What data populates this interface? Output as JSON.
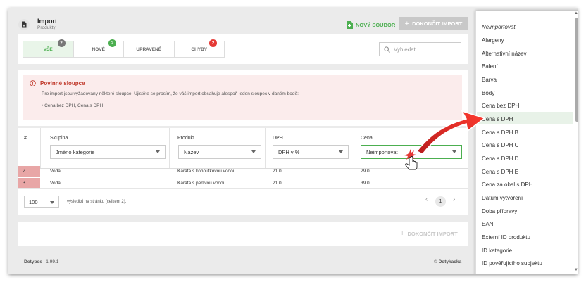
{
  "header": {
    "title": "Import",
    "subtitle": "Produkty",
    "new_file": "NOVÝ SOUBOR",
    "finish": "DOKONČIT IMPORT"
  },
  "tabs": [
    {
      "label": "VŠE",
      "count": "2",
      "badge_color": "#777777"
    },
    {
      "label": "NOVÉ",
      "count": "2",
      "badge_color": "#4caf50"
    },
    {
      "label": "UPRAVENÉ",
      "count": "",
      "badge_color": ""
    },
    {
      "label": "CHYBY",
      "count": "2",
      "badge_color": "#e53935"
    }
  ],
  "search": {
    "placeholder": "Vyhledat"
  },
  "alert": {
    "title": "Povinné sloupce",
    "text": "Pro import jsou vyžadovány některé sloupce. Ujistěte se prosím, že váš import obsahuje alespoň jeden sloupec v daném bodě:",
    "item": "Cena bez DPH, Cena s DPH"
  },
  "table": {
    "headers": [
      "#",
      "Skupina",
      "Produkt",
      "DPH",
      "Cena"
    ],
    "selects": [
      "Jméno kategorie",
      "Název",
      "DPH v %",
      "Neimportovat"
    ],
    "rows": [
      {
        "n": "2",
        "skupina": "Voda",
        "produkt": "Karafa s kohoutkovou vodou",
        "dph": "21.0",
        "cena": "29.0"
      },
      {
        "n": "3",
        "skupina": "Voda",
        "produkt": "Karafa s perlivou vodou",
        "dph": "21.0",
        "cena": "39.0"
      }
    ]
  },
  "pager": {
    "per_page": "100",
    "text": "výsledků na stránku (celkem 2).",
    "page": "1",
    "prev": "‹",
    "next": "›"
  },
  "footer": {
    "left_brand": "Dotypos",
    "version": "| 1.99.1",
    "right": "© Dotykacka"
  },
  "dropdown": {
    "items": [
      "Neimportovat",
      "Alergeny",
      "Alternativní název",
      "Balení",
      "Barva",
      "Body",
      "Cena bez DPH",
      "Cena s DPH",
      "Cena s DPH B",
      "Cena s DPH C",
      "Cena s DPH D",
      "Cena s DPH E",
      "Cena za obal s DPH",
      "Datum vytvoření",
      "Doba přípravy",
      "EAN",
      "Externí ID produktu",
      "ID kategorie",
      "ID pověřujícího subjektu"
    ],
    "highlighted": "Cena s DPH"
  },
  "colors": {
    "accent": "#4caf50",
    "error": "#e53935",
    "arrow": "#e53935"
  }
}
